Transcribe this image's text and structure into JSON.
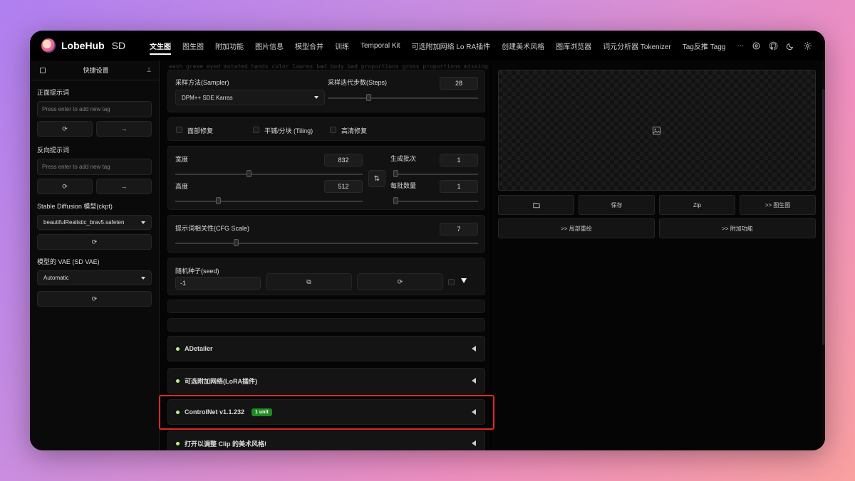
{
  "brand": {
    "name": "LobeHub",
    "suffix": "SD"
  },
  "tabs": [
    {
      "label": "文生图",
      "active": true
    },
    {
      "label": "图生图"
    },
    {
      "label": "附加功能"
    },
    {
      "label": "图片信息"
    },
    {
      "label": "模型合并"
    },
    {
      "label": "训练"
    },
    {
      "label": "Temporal Kit"
    },
    {
      "label": "可选附加网络 Lo RA插件"
    },
    {
      "label": "创建美术风格"
    },
    {
      "label": "图库浏览器"
    },
    {
      "label": "词元分析器 Tokenizer"
    },
    {
      "label": "Tag反推 Tagg"
    },
    {
      "label": "···"
    }
  ],
  "top_icons": [
    "settings-icon",
    "github-icon",
    "moon-icon",
    "gear-icon"
  ],
  "faint_text": "eash greae eyed mutated hands color lowres bad body bad proportions gross proportions missing arms missing legs extra digit, extra",
  "sidebar": {
    "title": "快捷设置",
    "positive_label": "正面提示词",
    "positive_placeholder": "Press enter to add new tag",
    "negative_label": "反向提示词",
    "negative_placeholder": "Press enter to add new tag",
    "ckpt_label": "Stable Diffusion 模型(ckpt)",
    "ckpt_value": "beautifulRealistic_brav5.safeten",
    "vae_label": "模型的 VAE (SD VAE)",
    "vae_value": "Automatic"
  },
  "sampler": {
    "label": "采样方法(Sampler)",
    "value": "DPM++ SDE Karras",
    "steps_label": "采样迭代步数(Steps)",
    "steps": "28",
    "steps_fraction": 0.27
  },
  "options": {
    "face_restore": "面部修复",
    "tiling": "平铺/分块 (Tiling)",
    "hires": "高清修复"
  },
  "size": {
    "width_label": "宽度",
    "width": "832",
    "width_fraction": 0.39,
    "height_label": "高度",
    "height": "512",
    "height_fraction": 0.23,
    "batch_count_label": "生成批次",
    "batch_count": "1",
    "batch_size_label": "每批数量",
    "batch_size": "1"
  },
  "cfg": {
    "label": "提示词相关性(CFG Scale)",
    "value": "7",
    "fraction": 0.2
  },
  "seed": {
    "label": "随机种子(seed)",
    "value": "-1"
  },
  "accordions": [
    {
      "title": "ADetailer"
    },
    {
      "title": "可选附加网络(LoRA插件)"
    },
    {
      "title": "ControlNet v1.1.232",
      "badge": "1 unit",
      "highlighted": true
    },
    {
      "title": "打开以调整 Clip 的美术风格!"
    }
  ],
  "output_buttons": {
    "folder": "folder-icon",
    "save": "保存",
    "zip": "Zip",
    "to_img2img": ">> 图生图",
    "to_inpaint": ">> 局部重绘",
    "to_extras": ">> 附加功能"
  },
  "colors": {
    "accent_dot": "#c0f080",
    "badge": "#1f8a1f",
    "highlight": "#e0262a"
  }
}
